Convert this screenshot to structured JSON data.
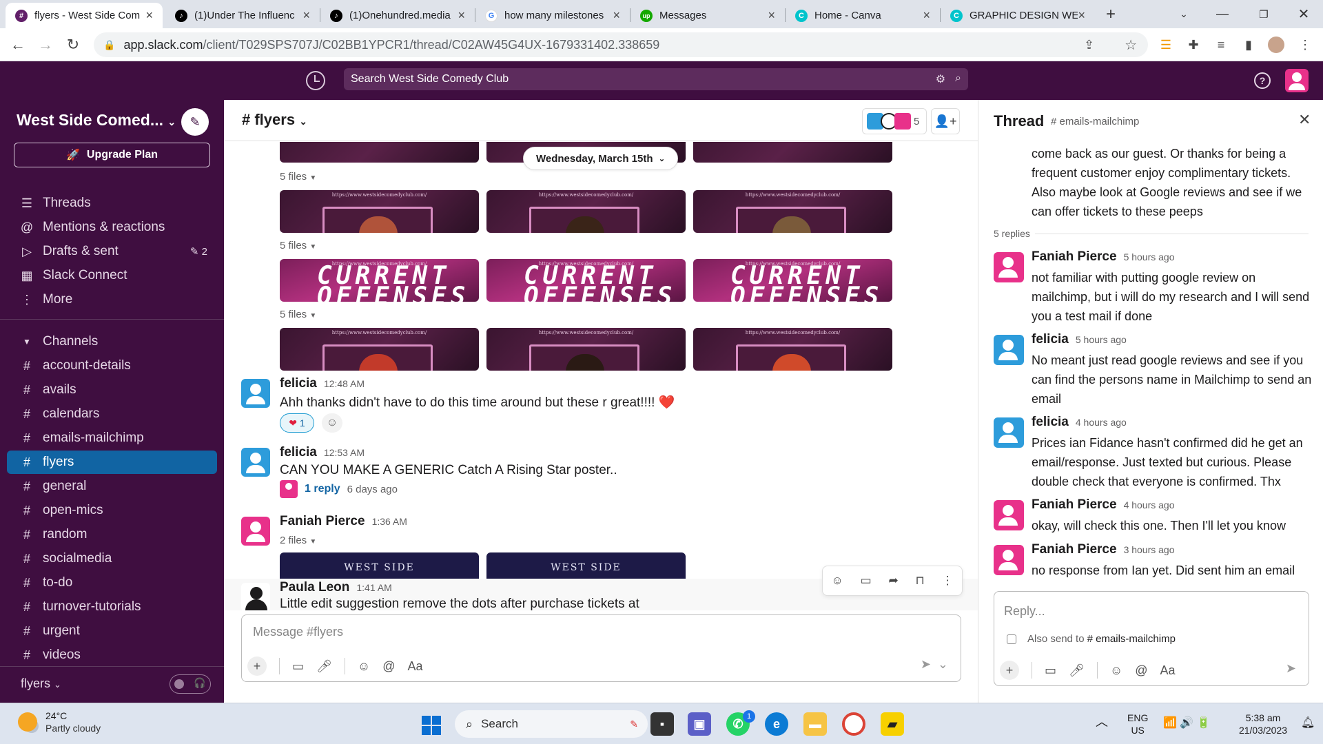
{
  "browser": {
    "tabs": [
      {
        "title": "flyers - West Side Com",
        "fav_color": "#611f69",
        "fav_glyph": "#"
      },
      {
        "title": "(1)Under The Influenc",
        "fav_color": "#000000",
        "fav_glyph": "♪"
      },
      {
        "title": "(1)Onehundred.media",
        "fav_color": "#000000",
        "fav_glyph": "♪"
      },
      {
        "title": "how many milestones",
        "fav_color": "#4285f4",
        "fav_glyph": "G"
      },
      {
        "title": "Messages",
        "fav_color": "#14a800",
        "fav_glyph": "up"
      },
      {
        "title": "Home - Canva",
        "fav_color": "#00c4cc",
        "fav_glyph": "C"
      },
      {
        "title": "GRAPHIC DESIGN WE",
        "fav_color": "#00c4cc",
        "fav_glyph": "C"
      }
    ],
    "url_host": "app.slack.com",
    "url_path": "/client/T029SPS707J/C02BB1YPCR1/thread/C02AW45G4UX-1679331402.338659"
  },
  "slack": {
    "search_placeholder": "Search West Side Comedy Club",
    "workspace_name": "West Side Comed...",
    "upgrade_label": "Upgrade Plan",
    "nav": [
      {
        "label": "Threads",
        "icon": "threads-icon",
        "glyph": "☰"
      },
      {
        "label": "Mentions & reactions",
        "icon": "at-icon",
        "glyph": "@"
      },
      {
        "label": "Drafts & sent",
        "icon": "send-icon",
        "glyph": "▷",
        "count": "2"
      },
      {
        "label": "Slack Connect",
        "icon": "building-icon",
        "glyph": "▦"
      },
      {
        "label": "More",
        "icon": "more-icon",
        "glyph": "⋮"
      }
    ],
    "channels_header": "Channels",
    "channels": [
      "account-details",
      "avails",
      "calendars",
      "emails-mailchimp",
      "flyers",
      "general",
      "open-mics",
      "random",
      "socialmedia",
      "to-do",
      "turnover-tutorials",
      "urgent",
      "videos"
    ],
    "active_channel": "flyers",
    "footer_channel": "flyers"
  },
  "channel": {
    "title": "# flyers",
    "member_count": "5",
    "date_divider": "Wednesday, March 15th",
    "files_label": "5 files",
    "thumb_url_text": "https://www.westsidecomedyclub.com/",
    "current_offenses": "CURRENT OFFENSES",
    "west_side": "WEST SIDE",
    "messages": [
      {
        "name": "felicia",
        "time": "12:48 AM",
        "text": "Ahh thanks didn't have to do this time around but these r great!!!!",
        "emoji": "❤️",
        "reaction_count": "1"
      },
      {
        "name": "felicia",
        "time": "12:53 AM",
        "text": "CAN YOU MAKE A GENERIC Catch A Rising Star poster..",
        "reply_count": "1 reply",
        "reply_ago": "6 days ago"
      },
      {
        "name": "Faniah Pierce",
        "time": "1:36 AM",
        "files": "2 files"
      },
      {
        "name": "Paula Leon",
        "time": "1:41 AM",
        "text": "Little edit suggestion remove the dots after purchase tickets at"
      }
    ],
    "composer_placeholder": "Message #flyers"
  },
  "thread": {
    "title": "Thread",
    "channel": "# emails-mailchimp",
    "parent_text": "come back as our guest.  Or thanks for being a frequent customer enjoy complimentary tickets.  Also maybe look at Google reviews and see if we can offer tickets to these peeps",
    "replies_label": "5 replies",
    "replies": [
      {
        "name": "Faniah Pierce",
        "time": "5 hours ago",
        "text": "not familiar with putting google review on mailchimp, but i will do my research and I will send you a test mail if done"
      },
      {
        "name": "felicia",
        "time": "5 hours ago",
        "text": "No meant just read google reviews and see if you can find the persons name in Mailchimp to send an email"
      },
      {
        "name": "felicia",
        "time": "4 hours ago",
        "text": "Prices ian Fidance hasn't confirmed did he get an email/response. Just texted but curious. Please double check that everyone is confirmed. Thx"
      },
      {
        "name": "Faniah Pierce",
        "time": "4 hours ago",
        "text": "okay, will check this one. Then I'll let you know"
      },
      {
        "name": "Faniah Pierce",
        "time": "3 hours ago",
        "text": "no response from Ian yet. Did sent him an email"
      }
    ],
    "reply_placeholder": "Reply...",
    "also_send": "Also send to",
    "also_send_channel": "# emails-mailchimp"
  },
  "taskbar": {
    "temp": "24°C",
    "weather": "Partly cloudy",
    "search": "Search",
    "lang1": "ENG",
    "lang2": "US",
    "time": "5:38 am",
    "date": "21/03/2023",
    "whatsapp_badge": "1"
  }
}
